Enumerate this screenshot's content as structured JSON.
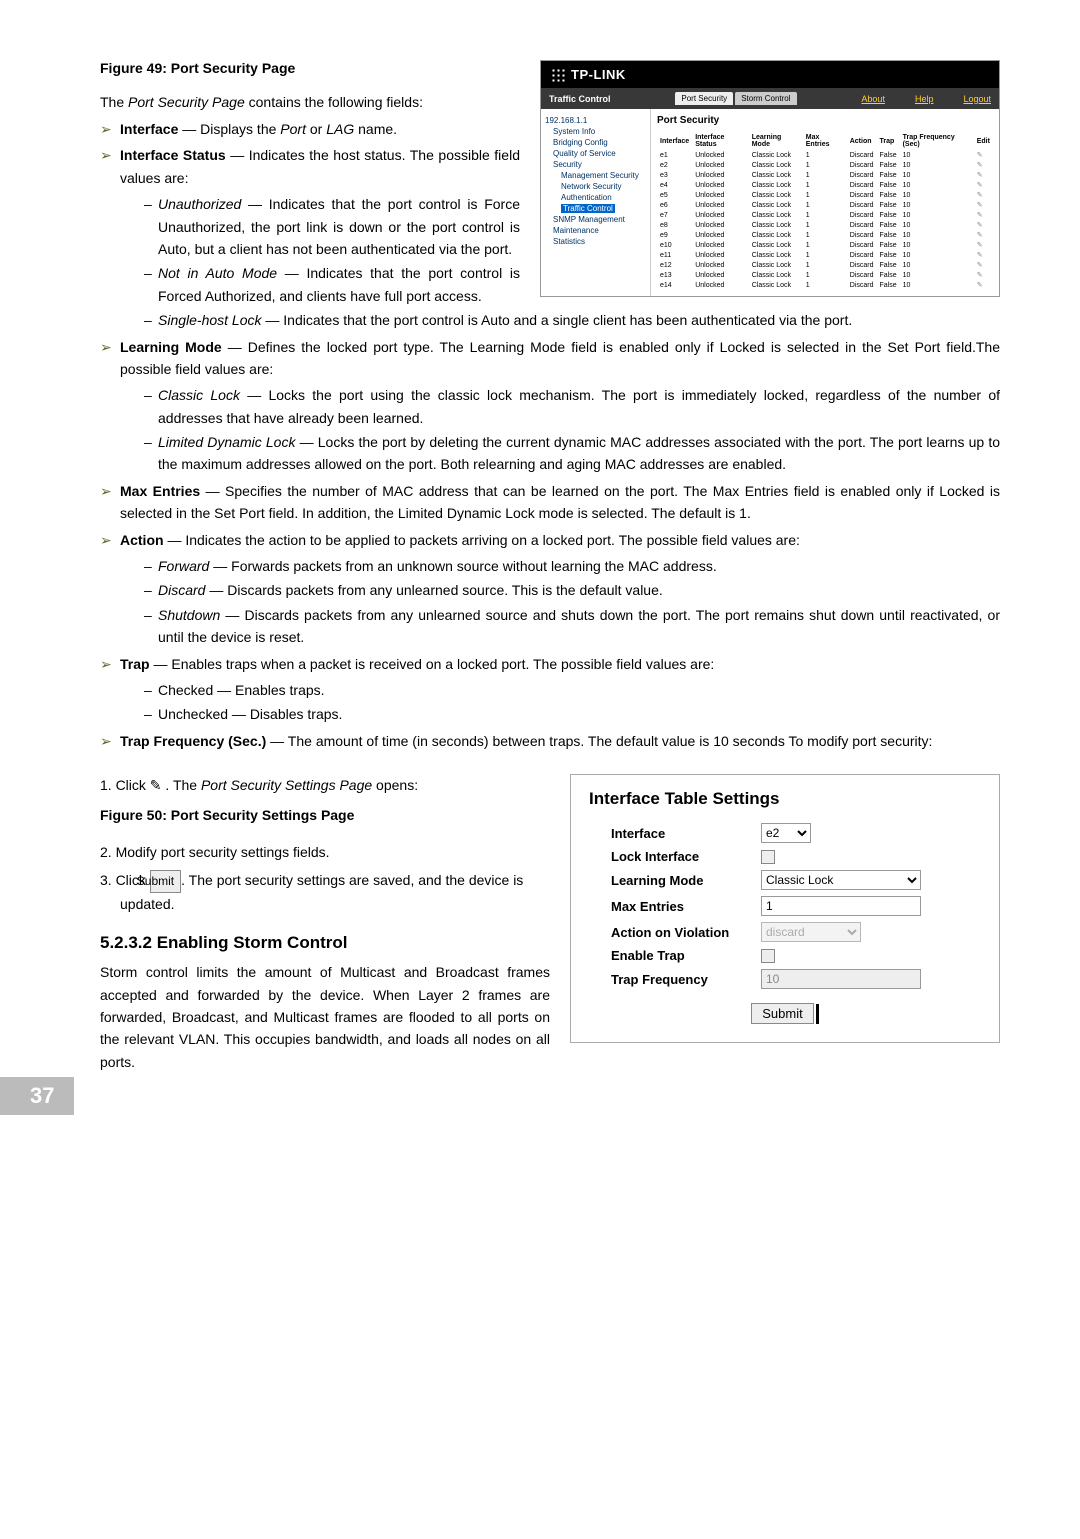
{
  "fig49_caption": "Figure 49: Port Security Page",
  "intro_prefix": "The ",
  "intro_em": "Port Security Page",
  "intro_suffix": " contains the following fields:",
  "f_interface_head": "Interface",
  "f_interface_body_a": " — Displays the ",
  "f_interface_body_b": "Port",
  "f_interface_body_c": " or ",
  "f_interface_body_d": "LAG",
  "f_interface_body_e": " name.",
  "f_ifstatus_head": "Interface Status",
  "f_ifstatus_body": " — Indicates the host status. The possible field values are:",
  "s_unauth_em": "Unauthorized",
  "s_unauth_body": " — Indicates that the port control is Force Unauthorized, the port link is down or the port control is Auto, but a client has not been authenticated via the port.",
  "s_notauto_em": "Not in Auto Mode",
  "s_notauto_body": " — Indicates that the port control is Forced Authorized, and clients have full port access.",
  "s_single_em": "Single-host Lock",
  "s_single_body": " — Indicates that the port control is Auto and a single client has been authenticated via the port.",
  "f_learn_head": "Learning Mode",
  "f_learn_body": " — Defines the locked port type. The Learning Mode field is enabled only if Locked is selected in the Set Port field.The possible field values are:",
  "s_classic_em": "Classic Lock",
  "s_classic_body": " — Locks the port using the classic lock mechanism. The port is immediately locked, regardless of the number of addresses that have already been learned.",
  "s_limited_em": "Limited Dynamic Lock",
  "s_limited_body": " — Locks the port by deleting the current dynamic MAC addresses associated with the port. The port learns up to the maximum addresses allowed on the port. Both relearning and aging MAC addresses are enabled.",
  "f_max_head": "Max Entries",
  "f_max_body": " — Specifies the number of MAC address that can be learned on the port. The Max Entries field is enabled only if Locked is selected in the Set Port field. In addition, the Limited Dynamic Lock mode is selected. The default is 1.",
  "f_action_head": "Action",
  "f_action_body": " — Indicates the action to be applied to packets arriving on a locked port. The possible field values are:",
  "s_forward_em": "Forward",
  "s_forward_body": " — Forwards packets from an unknown source without learning the MAC address.",
  "s_discard_em": "Discard",
  "s_discard_body": " — Discards packets from any unlearned source. This is the default value.",
  "s_shutdown_em": "Shutdown",
  "s_shutdown_body": " — Discards packets from any unlearned source and shuts down the port. The port remains shut down until reactivated, or until the device is reset.",
  "f_trap_head": "Trap",
  "f_trap_body": " — Enables traps when a packet is received on a locked port. The possible field values are:",
  "s_checked": "Checked — Enables traps.",
  "s_unchecked": "Unchecked — Disables traps.",
  "f_trapfreq_head": "Trap Frequency (Sec.)",
  "f_trapfreq_body": " — The amount of time (in seconds) between traps. The default value is 10 seconds To modify port security:",
  "step1_a": "1.   Click ",
  "step1_b": " . The ",
  "step1_em": "Port Security Settings Page",
  "step1_c": " opens:",
  "fig50_caption": "Figure 50: Port Security Settings Page",
  "step2": "2.   Modify port security settings fields.",
  "step3_a": "3.   Click ",
  "step3_b": ". The port security settings are saved, and the device is updated.",
  "submit_label": "Submit",
  "h3": "5.2.3.2  Enabling Storm Control",
  "storm_para": "Storm control limits the amount of Multicast and Broadcast frames accepted and forwarded by the device. When Layer 2 frames are forwarded, Broadcast, and Multicast frames are flooded to all ports on the relevant VLAN. This occupies bandwidth, and loads all nodes on all ports.",
  "page_num": "37",
  "tp": {
    "logo": "TP-LINK",
    "traffic": "Traffic Control",
    "tab_portsec": "Port Security",
    "tab_storm": "Storm Control",
    "link_about": "About",
    "link_help": "Help",
    "link_logout": "Logout",
    "title": "Port Security",
    "tree": {
      "root": "192.168.1.1",
      "sys": "System Info",
      "bridge": "Bridging Config",
      "qos": "Quality of Service",
      "sec": "Security",
      "mgmtsec": "Management Security",
      "netsec": "Network Security",
      "auth": "Authentication",
      "traffic": "Traffic Control",
      "snmp": "SNMP Management",
      "maint": "Maintenance",
      "stats": "Statistics"
    },
    "th": {
      "iface": "Interface",
      "ifstat": "Interface Status",
      "learn": "Learning Mode",
      "max": "Max Entries",
      "action": "Action",
      "trap": "Trap",
      "trapfreq": "Trap Frequency (Sec)",
      "edit": "Edit"
    },
    "rows": [
      {
        "if": "e1",
        "stat": "Unlocked",
        "lm": "Classic Lock",
        "me": "1",
        "act": "Discard",
        "trap": "False",
        "tf": "10"
      },
      {
        "if": "e2",
        "stat": "Unlocked",
        "lm": "Classic Lock",
        "me": "1",
        "act": "Discard",
        "trap": "False",
        "tf": "10"
      },
      {
        "if": "e3",
        "stat": "Unlocked",
        "lm": "Classic Lock",
        "me": "1",
        "act": "Discard",
        "trap": "False",
        "tf": "10"
      },
      {
        "if": "e4",
        "stat": "Unlocked",
        "lm": "Classic Lock",
        "me": "1",
        "act": "Discard",
        "trap": "False",
        "tf": "10"
      },
      {
        "if": "e5",
        "stat": "Unlocked",
        "lm": "Classic Lock",
        "me": "1",
        "act": "Discard",
        "trap": "False",
        "tf": "10"
      },
      {
        "if": "e6",
        "stat": "Unlocked",
        "lm": "Classic Lock",
        "me": "1",
        "act": "Discard",
        "trap": "False",
        "tf": "10"
      },
      {
        "if": "e7",
        "stat": "Unlocked",
        "lm": "Classic Lock",
        "me": "1",
        "act": "Discard",
        "trap": "False",
        "tf": "10"
      },
      {
        "if": "e8",
        "stat": "Unlocked",
        "lm": "Classic Lock",
        "me": "1",
        "act": "Discard",
        "trap": "False",
        "tf": "10"
      },
      {
        "if": "e9",
        "stat": "Unlocked",
        "lm": "Classic Lock",
        "me": "1",
        "act": "Discard",
        "trap": "False",
        "tf": "10"
      },
      {
        "if": "e10",
        "stat": "Unlocked",
        "lm": "Classic Lock",
        "me": "1",
        "act": "Discard",
        "trap": "False",
        "tf": "10"
      },
      {
        "if": "e11",
        "stat": "Unlocked",
        "lm": "Classic Lock",
        "me": "1",
        "act": "Discard",
        "trap": "False",
        "tf": "10"
      },
      {
        "if": "e12",
        "stat": "Unlocked",
        "lm": "Classic Lock",
        "me": "1",
        "act": "Discard",
        "trap": "False",
        "tf": "10"
      },
      {
        "if": "e13",
        "stat": "Unlocked",
        "lm": "Classic Lock",
        "me": "1",
        "act": "Discard",
        "trap": "False",
        "tf": "10"
      },
      {
        "if": "e14",
        "stat": "Unlocked",
        "lm": "Classic Lock",
        "me": "1",
        "act": "Discard",
        "trap": "False",
        "tf": "10"
      }
    ]
  },
  "iface": {
    "title": "Interface Table Settings",
    "l_interface": "Interface",
    "v_interface": "e2",
    "l_lock": "Lock Interface",
    "l_learn": "Learning Mode",
    "v_learn": "Classic Lock",
    "l_max": "Max Entries",
    "v_max": "1",
    "l_aov": "Action on Violation",
    "v_aov": "discard",
    "l_enabletrap": "Enable Trap",
    "l_trapfreq": "Trap Frequency",
    "v_trapfreq": "10",
    "submit": "Submit"
  }
}
